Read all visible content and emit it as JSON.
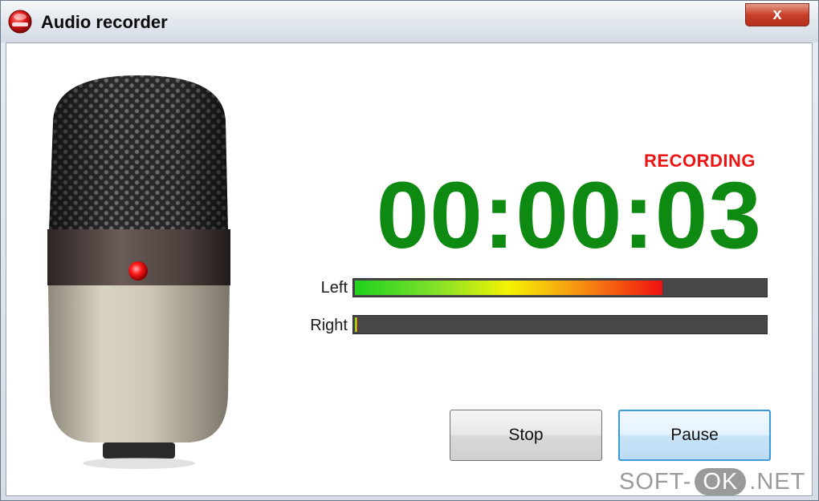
{
  "window": {
    "title": "Audio recorder",
    "close_glyph": "x",
    "app_icon": "record-icon"
  },
  "recorder": {
    "status": "RECORDING",
    "elapsed": "00:00:03",
    "status_color": "#ee1414",
    "timer_color": "#0e8a12"
  },
  "levels": {
    "left": {
      "label": "Left",
      "level": 0.75
    },
    "right": {
      "label": "Right",
      "level": 0.005
    }
  },
  "buttons": {
    "stop": "Stop",
    "pause": "Pause"
  },
  "watermark": {
    "left": "SOFT-",
    "middle": "OK",
    "right": ".NET"
  }
}
